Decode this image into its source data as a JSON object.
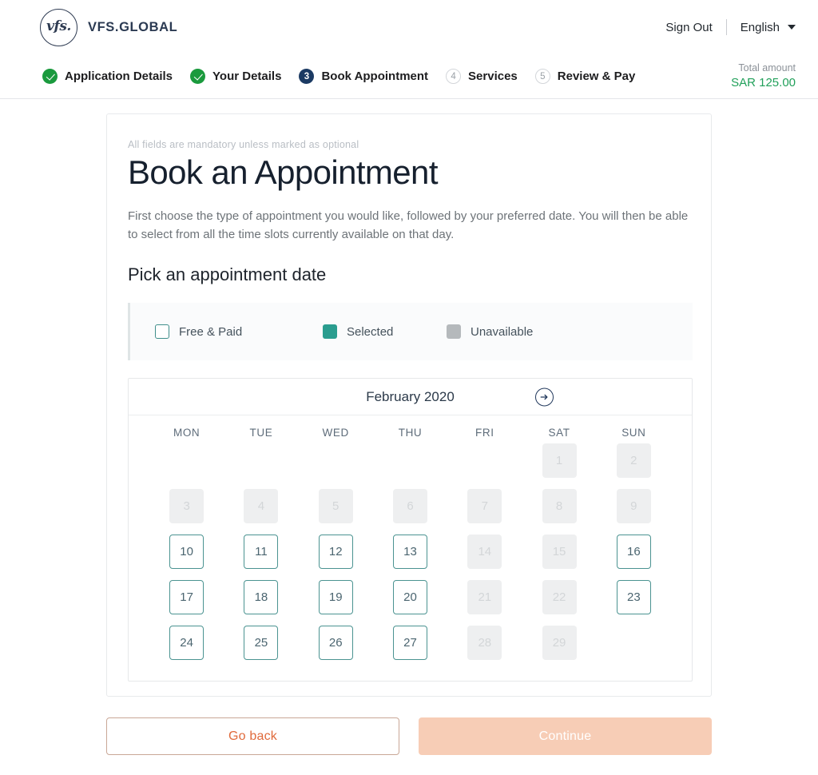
{
  "header": {
    "brand_mark": "vfs.",
    "brand_name": "VFS.GLOBAL",
    "sign_out": "Sign Out",
    "language": "English",
    "caret_icon": "chevron-down-icon"
  },
  "stepper": {
    "steps": [
      {
        "badge": "check-icon",
        "label": "Application Details",
        "state": "done"
      },
      {
        "badge": "check-icon",
        "label": "Your Details",
        "state": "done"
      },
      {
        "badge": "3",
        "label": "Book Appointment",
        "state": "current"
      },
      {
        "badge": "4",
        "label": "Services",
        "state": "todo"
      },
      {
        "badge": "5",
        "label": "Review & Pay",
        "state": "todo"
      }
    ],
    "total_label": "Total amount",
    "total_value": "SAR 125.00"
  },
  "form": {
    "mandatory_note": "All fields are mandatory unless marked as optional",
    "title": "Book an Appointment",
    "intro": "First choose the type of appointment you would like, followed by your preferred date. You will then be able to select from all the time slots currently available on that day.",
    "subtitle": "Pick an appointment date"
  },
  "legend": {
    "items": [
      {
        "label": "Free & Paid",
        "swatch": "free",
        "color": "#ffffff"
      },
      {
        "label": "Selected",
        "swatch": "selected",
        "color": "#2a9d8f"
      },
      {
        "label": "Unavailable",
        "swatch": "unavail",
        "color": "#b5b9bc"
      }
    ]
  },
  "calendar": {
    "month": "February 2020",
    "next_icon": "arrow-right-circle-icon",
    "day_headers": [
      "MON",
      "TUE",
      "WED",
      "THU",
      "FRI",
      "SAT",
      "SUN"
    ],
    "weeks": [
      [
        {
          "label": "",
          "state": "empty"
        },
        {
          "label": "",
          "state": "empty"
        },
        {
          "label": "",
          "state": "empty"
        },
        {
          "label": "",
          "state": "empty"
        },
        {
          "label": "",
          "state": "empty"
        },
        {
          "label": "1",
          "state": "unavail"
        },
        {
          "label": "2",
          "state": "unavail"
        }
      ],
      [
        {
          "label": "3",
          "state": "unavail"
        },
        {
          "label": "4",
          "state": "unavail"
        },
        {
          "label": "5",
          "state": "unavail"
        },
        {
          "label": "6",
          "state": "unavail"
        },
        {
          "label": "7",
          "state": "unavail"
        },
        {
          "label": "8",
          "state": "unavail"
        },
        {
          "label": "9",
          "state": "unavail"
        }
      ],
      [
        {
          "label": "10",
          "state": "avail"
        },
        {
          "label": "11",
          "state": "avail"
        },
        {
          "label": "12",
          "state": "avail"
        },
        {
          "label": "13",
          "state": "avail"
        },
        {
          "label": "14",
          "state": "unavail"
        },
        {
          "label": "15",
          "state": "unavail"
        },
        {
          "label": "16",
          "state": "avail"
        }
      ],
      [
        {
          "label": "17",
          "state": "avail"
        },
        {
          "label": "18",
          "state": "avail"
        },
        {
          "label": "19",
          "state": "avail"
        },
        {
          "label": "20",
          "state": "avail"
        },
        {
          "label": "21",
          "state": "unavail"
        },
        {
          "label": "22",
          "state": "unavail"
        },
        {
          "label": "23",
          "state": "avail"
        }
      ],
      [
        {
          "label": "24",
          "state": "avail"
        },
        {
          "label": "25",
          "state": "avail"
        },
        {
          "label": "26",
          "state": "avail"
        },
        {
          "label": "27",
          "state": "avail"
        },
        {
          "label": "28",
          "state": "unavail"
        },
        {
          "label": "29",
          "state": "unavail"
        },
        {
          "label": "",
          "state": "empty"
        }
      ]
    ]
  },
  "footer": {
    "go_back": "Go back",
    "continue": "Continue"
  }
}
